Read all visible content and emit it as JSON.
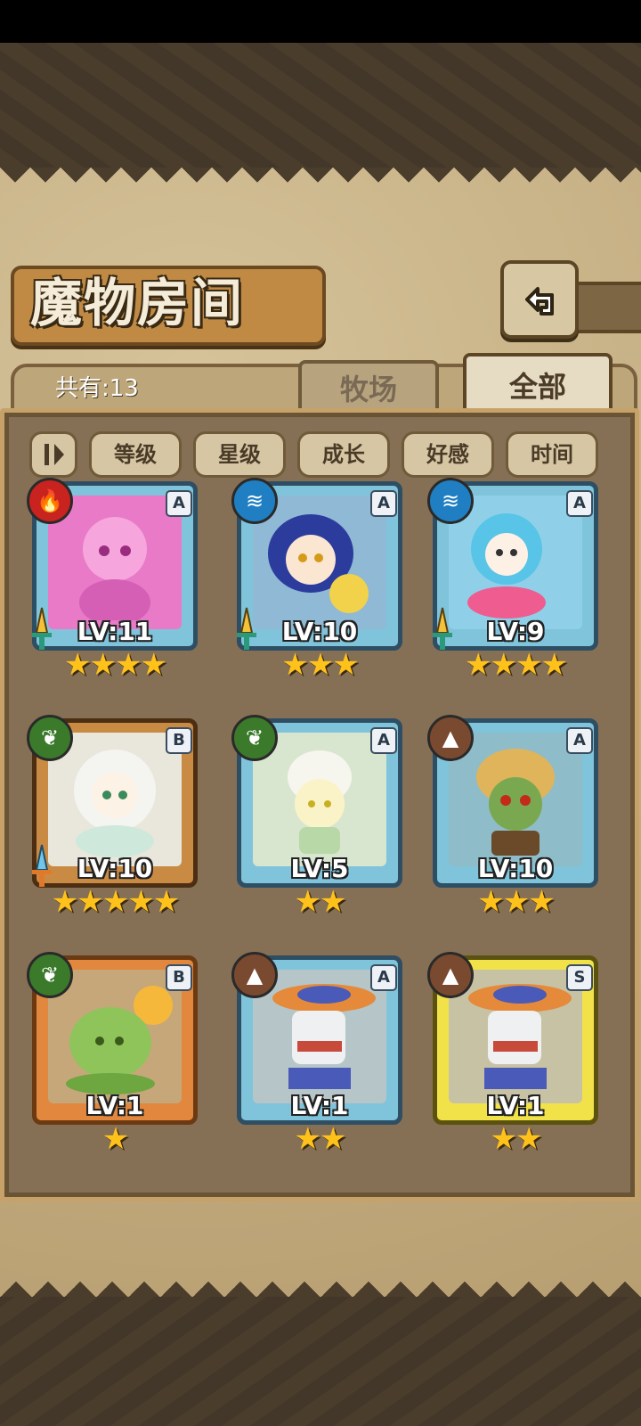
{
  "title": "魔物房间",
  "count_label": "共有:13",
  "tabs": [
    {
      "label": "牧场",
      "selected": false
    },
    {
      "label": "全部",
      "selected": true
    }
  ],
  "sort_buttons": [
    "等级",
    "星级",
    "成长",
    "好感",
    "时间"
  ],
  "icons": {
    "back": "back-arrow-icon",
    "sort_toggle": "sort-order-icon"
  },
  "colors": {
    "fire": "#c8231f",
    "water": "#1f7fc2",
    "grass": "#3a7a2a",
    "earth": "#7a4a30",
    "star": "#ffc21a"
  },
  "monsters": [
    {
      "level": "LV:11",
      "stars": "★★★★",
      "rank": "A",
      "element": "fire"
    },
    {
      "level": "LV:10",
      "stars": "★★★",
      "rank": "A",
      "element": "water"
    },
    {
      "level": "LV:9",
      "stars": "★★★★",
      "rank": "A",
      "element": "water"
    },
    {
      "level": "LV:10",
      "stars": "★★★★★",
      "rank": "B",
      "element": "grass"
    },
    {
      "level": "LV:5",
      "stars": "★★",
      "rank": "A",
      "element": "grass"
    },
    {
      "level": "LV:10",
      "stars": "★★★",
      "rank": "A",
      "element": "earth"
    },
    {
      "level": "LV:1",
      "stars": "★",
      "rank": "B",
      "element": "grass"
    },
    {
      "level": "LV:1",
      "stars": "★★",
      "rank": "A",
      "element": "earth"
    },
    {
      "level": "LV:1",
      "stars": "★★",
      "rank": "S",
      "element": "earth"
    }
  ]
}
